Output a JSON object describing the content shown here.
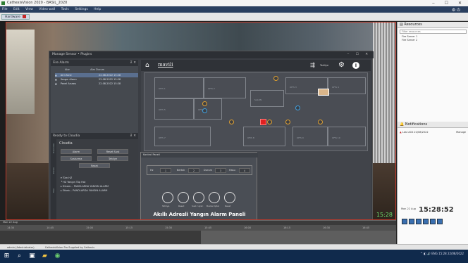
{
  "window": {
    "title": "CathexisVision 2020 - BASIL_2020",
    "controls": "‒ ☐ ✕"
  },
  "menu": [
    "File",
    "Edit",
    "View",
    "Video wall",
    "Tools",
    "Settings",
    "Help"
  ],
  "tab": {
    "label": "Hardware"
  },
  "plugin": {
    "title": "Manage Sensor • Plugins",
    "alarms_title": "Fire Alarm",
    "alarm_columns": [
      "Alar",
      "Alar Durum"
    ],
    "alarms": [
      {
        "name": "Alrl Zone",
        "time": "22.08.2022 15:28"
      },
      {
        "name": "Yangın Alarm",
        "time": "22.08.2022 15:28"
      },
      {
        "name": "Panel Arızası",
        "time": "22.08.2022 15:28"
      }
    ],
    "control_title": "Ready to Cloudia",
    "control_label": "Cloudia",
    "vtabs": [
      "Overview",
      "Zones",
      "Tree"
    ],
    "buttons": [
      "Alarm",
      "Reset Sust",
      "Susturma",
      "Tahliye",
      "Reset"
    ],
    "tree": [
      "▾ Tüm HZ",
      "  └ HZ Yangın Tüp Hat",
      "▸ Dinam... PANOLARDA YANGIN ALARM",
      "▸ Etkeb... PANOLARDA YANGIN ALARM"
    ]
  },
  "map": {
    "brand": "mavili",
    "evac_label": "Tahliye",
    "rooms": [
      "OFIS 1",
      "OFIS 2",
      "OFIS 3",
      "OFIS 4",
      "OFIS 5",
      "SALON",
      "OFIS 6",
      "OFIS 7",
      "OFIS 8",
      "OFIS 9",
      "OFIS 10"
    ]
  },
  "panel": {
    "head": "Kontrol Paneli",
    "zone_labels": [
      "Hz",
      "Bertat",
      "Durum",
      "Hasu"
    ],
    "zone_values": [
      "1",
      "2",
      "3",
      "4"
    ],
    "button_labels": [
      "Tahliye",
      "Reset",
      "Sust. Uyarı",
      "Buzzer Iptal",
      "Reset"
    ],
    "title": "Akıllı Adresli Yangın Alarm Paneli"
  },
  "camera": {
    "time": "15:28",
    "label": "15:28:52 22/08"
  },
  "sidebar": {
    "resources_title": "Resources",
    "search_placeholder": "Filter resources",
    "resources": [
      "Fire Server 1",
      "Fire Server 2"
    ],
    "notifications_title": "Notifications",
    "notification": "Last ACK 22/08/2022",
    "notification_state": "Manage",
    "date": "Mon 22 Aug",
    "clock": "15:28:52"
  },
  "timeline": {
    "label": "Mon 22 Aug",
    "ticks": [
      "14:30",
      "14:45",
      "15:00",
      "15:15",
      "15:30",
      "15:45",
      "16:00",
      "16:15",
      "16:30",
      "16:45"
    ]
  },
  "status": {
    "user": "admin (Administrator)",
    "product": "CathexisVision Pro   Supplied by Cathexis"
  },
  "taskbar": {
    "tray": "^ ◧ 🔊 ENG  15:28  22/08/2022"
  }
}
